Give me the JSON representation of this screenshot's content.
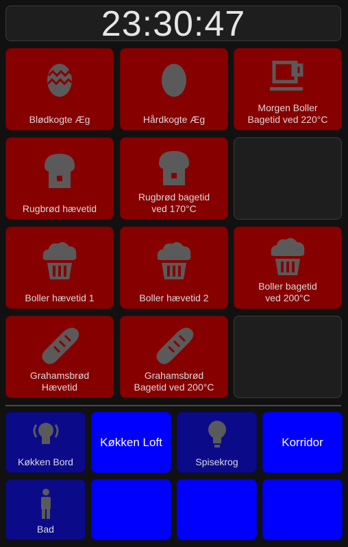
{
  "clock": {
    "time": "23:30:47"
  },
  "colors": {
    "tile_red": "#870000",
    "tile_empty": "#1e1e1e",
    "tile_navy": "#0b0b8a",
    "tile_blue": "#0000ff",
    "icon_gray": "#5a5a5a"
  },
  "kitchen_tiles": [
    {
      "label": "Blødkogte Æg",
      "icon": "easter-egg-icon"
    },
    {
      "label": "Hårdkogte Æg",
      "icon": "egg-icon"
    },
    {
      "label": "Morgen Boller\nBagetid ved 220°C",
      "icon": "coffee-cup-icon"
    },
    {
      "label": "Rugbrød hævetid",
      "icon": "bread-loaf-icon"
    },
    {
      "label": "Rugbrød bagetid\nved 170°C",
      "icon": "bread-loaf-icon"
    },
    {
      "label": "Boller hævetid 1",
      "icon": "muffin-icon"
    },
    {
      "label": "Boller hævetid 2",
      "icon": "muffin-icon"
    },
    {
      "label": "Boller bagetid\nved 200°C",
      "icon": "muffin-icon"
    },
    {
      "label": "Grahamsbrød\nHævetid",
      "icon": "baguette-icon"
    },
    {
      "label": "Grahamsbrød\nBagetid ved 200°C",
      "icon": "baguette-icon"
    }
  ],
  "light_tiles": [
    {
      "label": "Køkken Bord",
      "icon": "ceiling-light-icon"
    },
    {
      "label": "Køkken Loft"
    },
    {
      "label": "Spisekrog",
      "icon": "lightbulb-icon"
    },
    {
      "label": "Korridor"
    },
    {
      "label": "Bad",
      "icon": "person-icon"
    }
  ]
}
